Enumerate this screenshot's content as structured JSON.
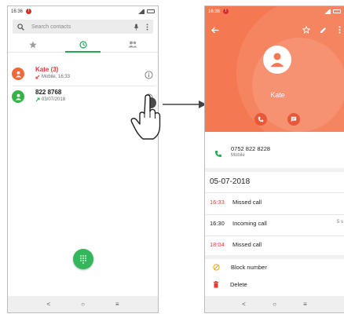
{
  "left_phone": {
    "status_time": "16:36",
    "search_placeholder": "Search contacts",
    "calls": [
      {
        "name": "Kate (3)",
        "detail": "Mobile, 16:33",
        "name_color": "#e53935",
        "type": "missed"
      },
      {
        "name": "822 8768",
        "detail": "03/07/2018",
        "name_color": "#222222",
        "type": "outgoing"
      }
    ],
    "nav": [
      "<",
      "○",
      "≡"
    ]
  },
  "right_phone": {
    "status_time": "16:36",
    "contact_name": "Kate",
    "phone_number": "0752 822 8228",
    "phone_type": "Mobile",
    "date_header": "05-07-2018",
    "history": [
      {
        "time": "16:33",
        "label": "Missed call",
        "missed": true,
        "extra": ""
      },
      {
        "time": "16:30",
        "label": "Incoming call",
        "missed": false,
        "extra": "5 s"
      },
      {
        "time": "18:04",
        "label": "Missed call",
        "missed": true,
        "extra": ""
      }
    ],
    "options": [
      {
        "label": "Block number",
        "icon": "block-icon"
      },
      {
        "label": "Delete",
        "icon": "trash-icon"
      }
    ],
    "nav": [
      "<",
      "○",
      "≡"
    ]
  },
  "colors": {
    "accent_green": "#20a954",
    "header_orange": "#f47850",
    "missed_red": "#e53935"
  }
}
